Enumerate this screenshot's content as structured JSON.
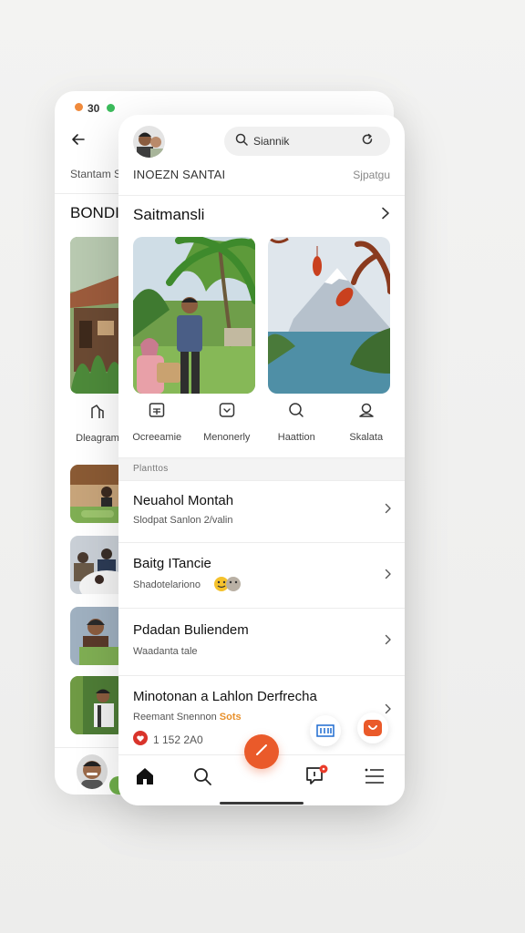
{
  "back_screen": {
    "status_text": "30",
    "subtitle": "Stantam S",
    "section_title": "BONDI",
    "action_label": "Dleagram",
    "dot_colors": [
      "#f08a3c",
      "#3cbc5c"
    ]
  },
  "front_screen": {
    "search": {
      "value": "Siannik",
      "icon": "search-icon"
    },
    "header_left": "INOEZN SANTAI",
    "header_right": "Sjpatgu",
    "section_title": "Saitmansli",
    "actions": [
      {
        "label": "Ocreeamie",
        "icon": "calendar-icon"
      },
      {
        "label": "Menonerly",
        "icon": "message-icon"
      },
      {
        "label": "Haattion",
        "icon": "search-icon"
      },
      {
        "label": "Skalata",
        "icon": "person-icon"
      }
    ],
    "band_label": "Planttos",
    "list": [
      {
        "title": "Neuahol Montah",
        "subtitle": "Slodpat Sanlon 2/valin"
      },
      {
        "title": "Baitg ITancie",
        "subtitle": "Shadotelariono"
      },
      {
        "title": "Pdadan Buliendem",
        "subtitle": "Waadanta tale"
      },
      {
        "title": "Minotonan a Lahlon Derfrecha",
        "subtitle": "Reemant Snennon",
        "subtitle_accent": "Sots",
        "meta": "1 152 2A0"
      }
    ],
    "brand_color": "#ea5a2a"
  }
}
